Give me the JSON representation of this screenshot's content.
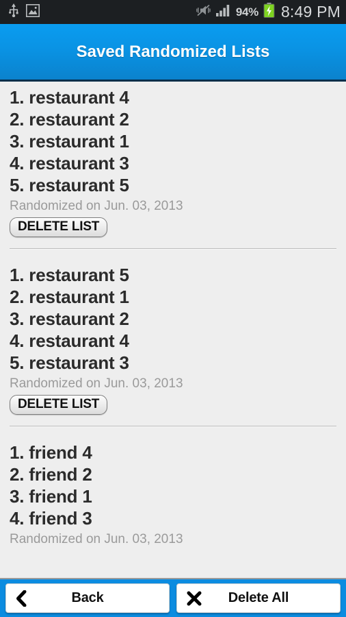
{
  "statusbar": {
    "left_icons": [
      "usb-icon",
      "screenshot-image-icon"
    ],
    "right_icons": [
      "vibrate-mute-icon",
      "signal-bars-icon",
      "battery-charging-icon"
    ],
    "battery_percent": "94%",
    "clock": "8:49 PM",
    "background": "#1c1f22",
    "text_color": "#d8dadc"
  },
  "header": {
    "title": "Saved Randomized Lists",
    "background_top": "#0a9cf0",
    "background_bottom": "#0b82cd",
    "text_color": "#ffffff"
  },
  "saved_lists": [
    {
      "items": [
        "1. restaurant 4",
        "2. restaurant 2",
        "3. restaurant 1",
        "4. restaurant 3",
        "5. restaurant 5"
      ],
      "meta": "Randomized on Jun. 03, 2013",
      "delete_label": "DELETE LIST"
    },
    {
      "items": [
        "1. restaurant 5",
        "2. restaurant 1",
        "3. restaurant 2",
        "4. restaurant 4",
        "5. restaurant 3"
      ],
      "meta": "Randomized on Jun. 03, 2013",
      "delete_label": "DELETE LIST"
    },
    {
      "items": [
        "1. friend 4",
        "2. friend 2",
        "3. friend 1",
        "4. friend 3"
      ],
      "meta": "Randomized on Jun. 03, 2013"
    }
  ],
  "bottombar": {
    "background": "#0c8ce0",
    "back_label": "Back",
    "back_icon": "chevron-left-icon",
    "delete_all_label": "Delete All",
    "delete_all_icon": "close-x-icon"
  }
}
